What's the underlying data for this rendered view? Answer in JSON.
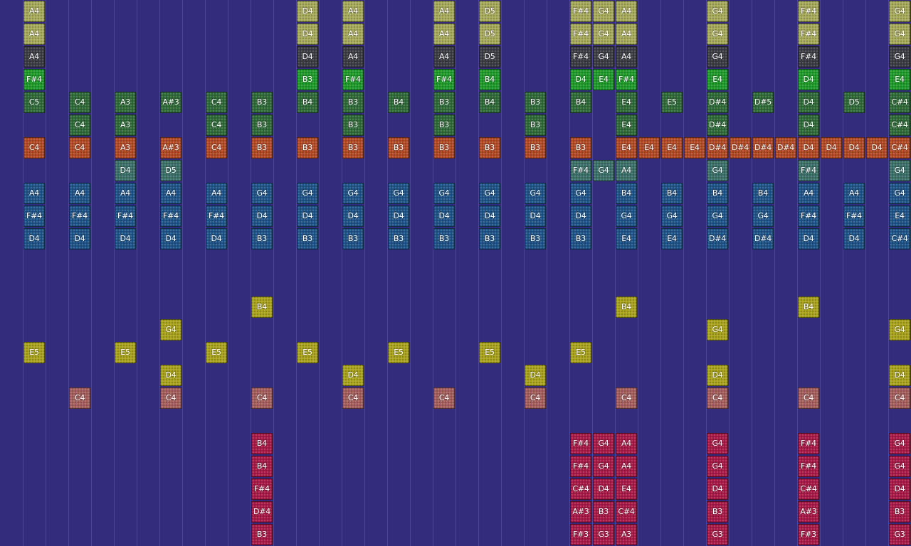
{
  "palette": {
    "background": "#332b7b",
    "grid_line": "#4c4596",
    "olive": "#a6a85a",
    "dark_gray": "#3c3c44",
    "green": "#1f9a2a",
    "dark_green": "#2f6a38",
    "orange": "#b24a26",
    "teal": "#3b7069",
    "blue": "#1f5488",
    "yellow": "#a8a21c",
    "salmon": "#a45e5c",
    "crimson": "#a81a48"
  },
  "rows": [
    {
      "color": "olive",
      "notes": [
        [
          "A4",
          1
        ],
        [
          "D4",
          13
        ],
        [
          "A4",
          15
        ],
        [
          "A4",
          19
        ],
        [
          "D5",
          21
        ],
        [
          "F#4",
          25
        ],
        [
          "G4",
          26
        ],
        [
          "A4",
          27
        ],
        [
          "G4",
          31
        ],
        [
          "F#4",
          35
        ],
        [
          "G4",
          39
        ]
      ]
    },
    {
      "color": "olive",
      "notes": [
        [
          "A4",
          1
        ],
        [
          "D4",
          13
        ],
        [
          "A4",
          15
        ],
        [
          "A4",
          19
        ],
        [
          "D5",
          21
        ],
        [
          "F#4",
          25
        ],
        [
          "G4",
          26
        ],
        [
          "A4",
          27
        ],
        [
          "G4",
          31
        ],
        [
          "F#4",
          35
        ],
        [
          "G4",
          39
        ]
      ]
    },
    {
      "color": "dark_gray",
      "notes": [
        [
          "A4",
          1
        ],
        [
          "D4",
          13
        ],
        [
          "A4",
          15
        ],
        [
          "A4",
          19
        ],
        [
          "D5",
          21
        ],
        [
          "F#4",
          25
        ],
        [
          "G4",
          26
        ],
        [
          "A4",
          27
        ],
        [
          "G4",
          31
        ],
        [
          "F#4",
          35
        ],
        [
          "G4",
          39
        ]
      ]
    },
    {
      "color": "green",
      "notes": [
        [
          "F#4",
          1
        ],
        [
          "B3",
          13
        ],
        [
          "F#4",
          15
        ],
        [
          "F#4",
          19
        ],
        [
          "B4",
          21
        ],
        [
          "D4",
          25
        ],
        [
          "E4",
          26
        ],
        [
          "F#4",
          27
        ],
        [
          "E4",
          31
        ],
        [
          "D4",
          35
        ],
        [
          "E4",
          39
        ]
      ]
    },
    {
      "color": "dark_green",
      "notes": [
        [
          "C5",
          1
        ],
        [
          "C4",
          3
        ],
        [
          "A3",
          5
        ],
        [
          "A#3",
          7
        ],
        [
          "C4",
          9
        ],
        [
          "B3",
          11
        ],
        [
          "B4",
          13
        ],
        [
          "B3",
          15
        ],
        [
          "B4",
          17
        ],
        [
          "B3",
          19
        ],
        [
          "B4",
          21
        ],
        [
          "B3",
          23
        ],
        [
          "B4",
          25
        ],
        [
          "E4",
          27
        ],
        [
          "E5",
          29
        ],
        [
          "D#4",
          31
        ],
        [
          "D#5",
          33
        ],
        [
          "D4",
          35
        ],
        [
          "D5",
          37
        ],
        [
          "C#4",
          39
        ]
      ]
    },
    {
      "color": "dark_green",
      "notes": [
        [
          "C4",
          3
        ],
        [
          "A3",
          5
        ],
        [
          "C4",
          9
        ],
        [
          "B3",
          11
        ],
        [
          "B3",
          15
        ],
        [
          "B3",
          19
        ],
        [
          "B3",
          23
        ],
        [
          "E4",
          27
        ],
        [
          "D#4",
          31
        ],
        [
          "D4",
          35
        ],
        [
          "C#4",
          39
        ]
      ]
    },
    {
      "color": "orange",
      "notes": [
        [
          "C4",
          1
        ],
        [
          "C4",
          3
        ],
        [
          "A3",
          5
        ],
        [
          "A#3",
          7
        ],
        [
          "C4",
          9
        ],
        [
          "B3",
          11
        ],
        [
          "B3",
          13
        ],
        [
          "B3",
          15
        ],
        [
          "B3",
          17
        ],
        [
          "B3",
          19
        ],
        [
          "B3",
          21
        ],
        [
          "B3",
          23
        ],
        [
          "B3",
          25
        ],
        [
          "E4",
          27
        ],
        [
          "E4",
          28
        ],
        [
          "E4",
          29
        ],
        [
          "E4",
          30
        ],
        [
          "D#4",
          31
        ],
        [
          "D#4",
          32
        ],
        [
          "D#4",
          33
        ],
        [
          "D#4",
          34
        ],
        [
          "D4",
          35
        ],
        [
          "D4",
          36
        ],
        [
          "D4",
          37
        ],
        [
          "D4",
          38
        ],
        [
          "C#4",
          39
        ]
      ]
    },
    {
      "color": "teal",
      "notes": [
        [
          "D4",
          5
        ],
        [
          "D5",
          7
        ],
        [
          "F#4",
          25
        ],
        [
          "G4",
          26
        ],
        [
          "A4",
          27
        ],
        [
          "G4",
          31
        ],
        [
          "F#4",
          35
        ],
        [
          "G4",
          39
        ]
      ]
    },
    {
      "color": "blue",
      "notes": [
        [
          "A4",
          1
        ],
        [
          "A4",
          3
        ],
        [
          "A4",
          5
        ],
        [
          "A4",
          7
        ],
        [
          "A4",
          9
        ],
        [
          "G4",
          11
        ],
        [
          "G4",
          13
        ],
        [
          "G4",
          15
        ],
        [
          "G4",
          17
        ],
        [
          "G4",
          19
        ],
        [
          "G4",
          21
        ],
        [
          "G4",
          23
        ],
        [
          "G4",
          25
        ],
        [
          "B4",
          27
        ],
        [
          "B4",
          29
        ],
        [
          "B4",
          31
        ],
        [
          "B4",
          33
        ],
        [
          "A4",
          35
        ],
        [
          "A4",
          37
        ],
        [
          "G4",
          39
        ]
      ]
    },
    {
      "color": "blue",
      "notes": [
        [
          "F#4",
          1
        ],
        [
          "F#4",
          3
        ],
        [
          "F#4",
          5
        ],
        [
          "F#4",
          7
        ],
        [
          "F#4",
          9
        ],
        [
          "D4",
          11
        ],
        [
          "D4",
          13
        ],
        [
          "D4",
          15
        ],
        [
          "D4",
          17
        ],
        [
          "D4",
          19
        ],
        [
          "D4",
          21
        ],
        [
          "D4",
          23
        ],
        [
          "D4",
          25
        ],
        [
          "G4",
          27
        ],
        [
          "G4",
          29
        ],
        [
          "G4",
          31
        ],
        [
          "G4",
          33
        ],
        [
          "F#4",
          35
        ],
        [
          "F#4",
          37
        ],
        [
          "E4",
          39
        ]
      ]
    },
    {
      "color": "blue",
      "notes": [
        [
          "D4",
          1
        ],
        [
          "D4",
          3
        ],
        [
          "D4",
          5
        ],
        [
          "D4",
          7
        ],
        [
          "D4",
          9
        ],
        [
          "B3",
          11
        ],
        [
          "B3",
          13
        ],
        [
          "B3",
          15
        ],
        [
          "B3",
          17
        ],
        [
          "B3",
          19
        ],
        [
          "B3",
          21
        ],
        [
          "B3",
          23
        ],
        [
          "B3",
          25
        ],
        [
          "E4",
          27
        ],
        [
          "E4",
          29
        ],
        [
          "D#4",
          31
        ],
        [
          "D#4",
          33
        ],
        [
          "D4",
          35
        ],
        [
          "D4",
          37
        ],
        [
          "C#4",
          39
        ]
      ]
    },
    {
      "color": "blue",
      "notes": []
    },
    {
      "color": "blue",
      "notes": []
    },
    {
      "color": "yellow",
      "notes": [
        [
          "B4",
          11
        ],
        [
          "B4",
          27
        ],
        [
          "B4",
          35
        ]
      ]
    },
    {
      "color": "yellow",
      "notes": [
        [
          "G4",
          7
        ],
        [
          "G4",
          31
        ],
        [
          "G4",
          39
        ]
      ]
    },
    {
      "color": "yellow",
      "notes": [
        [
          "E5",
          1
        ],
        [
          "E5",
          5
        ],
        [
          "E5",
          9
        ],
        [
          "E5",
          13
        ],
        [
          "E5",
          17
        ],
        [
          "E5",
          21
        ],
        [
          "E5",
          25
        ]
      ]
    },
    {
      "color": "yellow",
      "notes": [
        [
          "D4",
          7
        ],
        [
          "D4",
          15
        ],
        [
          "D4",
          23
        ],
        [
          "D4",
          31
        ],
        [
          "D4",
          39
        ]
      ]
    },
    {
      "color": "salmon",
      "notes": [
        [
          "C4",
          3
        ],
        [
          "C4",
          7
        ],
        [
          "C4",
          11
        ],
        [
          "C4",
          15
        ],
        [
          "C4",
          19
        ],
        [
          "C4",
          23
        ],
        [
          "C4",
          27
        ],
        [
          "C4",
          31
        ],
        [
          "C4",
          35
        ],
        [
          "C4",
          39
        ]
      ]
    },
    {
      "color": "salmon",
      "notes": []
    },
    {
      "color": "crimson",
      "notes": [
        [
          "B4",
          11
        ],
        [
          "F#4",
          25
        ],
        [
          "G4",
          26
        ],
        [
          "A4",
          27
        ],
        [
          "G4",
          31
        ],
        [
          "F#4",
          35
        ],
        [
          "G4",
          39
        ]
      ]
    },
    {
      "color": "crimson",
      "notes": [
        [
          "B4",
          11
        ],
        [
          "F#4",
          25
        ],
        [
          "G4",
          26
        ],
        [
          "A4",
          27
        ],
        [
          "G4",
          31
        ],
        [
          "F#4",
          35
        ],
        [
          "G4",
          39
        ]
      ]
    },
    {
      "color": "crimson",
      "notes": [
        [
          "F#4",
          11
        ],
        [
          "C#4",
          25
        ],
        [
          "D4",
          26
        ],
        [
          "E4",
          27
        ],
        [
          "D4",
          31
        ],
        [
          "C#4",
          35
        ],
        [
          "D4",
          39
        ]
      ]
    },
    {
      "color": "crimson",
      "notes": [
        [
          "D#4",
          11
        ],
        [
          "A#3",
          25
        ],
        [
          "B3",
          26
        ],
        [
          "C#4",
          27
        ],
        [
          "B3",
          31
        ],
        [
          "A#3",
          35
        ],
        [
          "B3",
          39
        ]
      ]
    },
    {
      "color": "crimson",
      "notes": [
        [
          "B3",
          11
        ],
        [
          "F#3",
          25
        ],
        [
          "G3",
          26
        ],
        [
          "A3",
          27
        ],
        [
          "G3",
          31
        ],
        [
          "F#3",
          35
        ],
        [
          "G3",
          39
        ]
      ]
    }
  ]
}
